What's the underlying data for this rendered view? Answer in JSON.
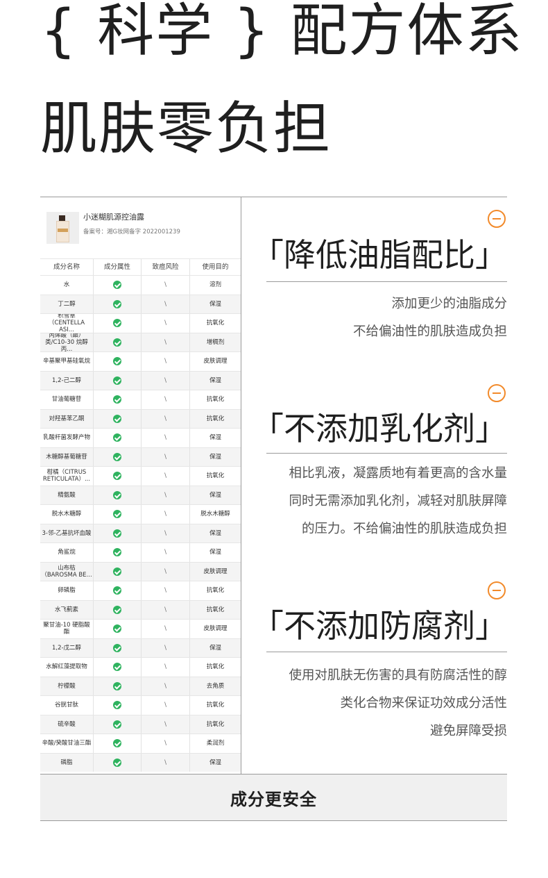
{
  "headline": {
    "line1": "{ 科学 } 配方体系",
    "line2": "肌肤零负担"
  },
  "product": {
    "name": "小迷糊肌源控油露",
    "registration": "备案号：湘G妆网备字 2022001239"
  },
  "table": {
    "headers": [
      "成分名称",
      "成分属性",
      "致痘风险",
      "使用目的"
    ],
    "rows": [
      {
        "name": "水",
        "risk": "\\",
        "purpose": "溶剂"
      },
      {
        "name": "丁二醇",
        "risk": "\\",
        "purpose": "保湿"
      },
      {
        "name": "积雪草（CENTELLA ASI...",
        "risk": "\\",
        "purpose": "抗氧化"
      },
      {
        "name": "丙烯酸（酯）类/C10-30 烷醇丙...",
        "risk": "\\",
        "purpose": "增稠剂"
      },
      {
        "name": "辛基聚甲基硅氧烷",
        "risk": "\\",
        "purpose": "皮肤调理"
      },
      {
        "name": "1,2-己二醇",
        "risk": "\\",
        "purpose": "保湿"
      },
      {
        "name": "甘油葡糖苷",
        "risk": "\\",
        "purpose": "抗氧化"
      },
      {
        "name": "对羟基苯乙酮",
        "risk": "\\",
        "purpose": "抗氧化"
      },
      {
        "name": "乳酸杆菌发酵产物",
        "risk": "\\",
        "purpose": "保湿"
      },
      {
        "name": "木糖醇基葡糖苷",
        "risk": "\\",
        "purpose": "保湿"
      },
      {
        "name": "柑橘（CITRUS RETICULATA）...",
        "risk": "\\",
        "purpose": "抗氧化"
      },
      {
        "name": "精氨酸",
        "risk": "\\",
        "purpose": "保湿"
      },
      {
        "name": "脱水木糖醇",
        "risk": "\\",
        "purpose": "脱水木糖醇"
      },
      {
        "name": "3-邻-乙基抗坏血酸",
        "risk": "\\",
        "purpose": "保湿"
      },
      {
        "name": "角鲨烷",
        "risk": "\\",
        "purpose": "保湿"
      },
      {
        "name": "山布枯（BAROSMA BE...",
        "risk": "\\",
        "purpose": "皮肤调理"
      },
      {
        "name": "卵磷脂",
        "risk": "\\",
        "purpose": "抗氧化"
      },
      {
        "name": "水飞蓟素",
        "risk": "\\",
        "purpose": "抗氧化"
      },
      {
        "name": "聚甘油-10 硬脂酸酯",
        "risk": "\\",
        "purpose": "皮肤调理"
      },
      {
        "name": "1,2-戊二醇",
        "risk": "\\",
        "purpose": "保湿"
      },
      {
        "name": "水解红藻提取物",
        "risk": "\\",
        "purpose": "抗氧化"
      },
      {
        "name": "柠檬酸",
        "risk": "\\",
        "purpose": "去角质"
      },
      {
        "name": "谷胱甘肽",
        "risk": "\\",
        "purpose": "抗氧化"
      },
      {
        "name": "硫辛酸",
        "risk": "\\",
        "purpose": "抗氧化"
      },
      {
        "name": "辛酸/癸酸甘油三酯",
        "risk": "\\",
        "purpose": "柔润剂"
      },
      {
        "name": "磷脂",
        "risk": "\\",
        "purpose": "保湿"
      }
    ]
  },
  "sections": [
    {
      "title": "「降低油脂配比」",
      "lines": [
        "添加更少的油脂成分",
        "不给偏油性的肌肤造成负担"
      ]
    },
    {
      "title": "「不添加乳化剂」",
      "lines": [
        "相比乳液，凝露质地有着更高的含水量",
        "同时无需添加乳化剂，减轻对肌肤屏障",
        "的压力。不给偏油性的肌肤造成负担"
      ]
    },
    {
      "title": "「不添加防腐剂」",
      "lines": [
        "使用对肌肤无伤害的具有防腐活性的醇",
        "类化合物来保证功效成分活性",
        "避免屏障受损"
      ]
    }
  ],
  "footer": {
    "label": "成分更安全"
  },
  "icons": {
    "section_icon": "minus-circle-icon",
    "attribute_icon": "check-circle-icon"
  },
  "colors": {
    "accent": "#f28a2a",
    "check": "#2fb35f"
  }
}
